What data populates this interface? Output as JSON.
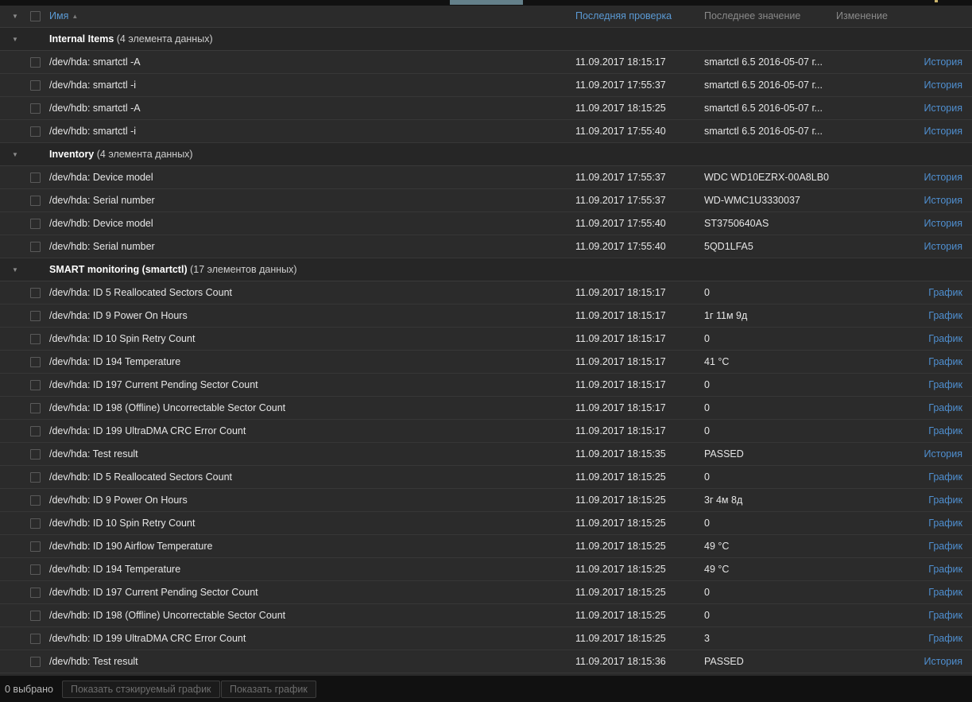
{
  "header": {
    "caret": "▼",
    "columns": {
      "name": "Имя",
      "sort_arrow": "▲",
      "last_check": "Последняя проверка",
      "last_value": "Последнее значение",
      "change": "Изменение"
    }
  },
  "links": {
    "history": "История",
    "graph": "График"
  },
  "groups": [
    {
      "caret": "▼",
      "title": "Internal Items",
      "count": "(4 элемента данных)",
      "rows": [
        {
          "name": "/dev/hda: smartctl -A",
          "time": "11.09.2017 18:15:17",
          "value": "smartctl 6.5 2016-05-07 г...",
          "link": "История"
        },
        {
          "name": "/dev/hda: smartctl -i",
          "time": "11.09.2017 17:55:37",
          "value": "smartctl 6.5 2016-05-07 г...",
          "link": "История"
        },
        {
          "name": "/dev/hdb: smartctl -A",
          "time": "11.09.2017 18:15:25",
          "value": "smartctl 6.5 2016-05-07 г...",
          "link": "История"
        },
        {
          "name": "/dev/hdb: smartctl -i",
          "time": "11.09.2017 17:55:40",
          "value": "smartctl 6.5 2016-05-07 г...",
          "link": "История"
        }
      ]
    },
    {
      "caret": "▼",
      "title": "Inventory",
      "count": "(4 элемента данных)",
      "rows": [
        {
          "name": "/dev/hda: Device model",
          "time": "11.09.2017 17:55:37",
          "value": "WDC WD10EZRX-00A8LB0",
          "link": "История"
        },
        {
          "name": "/dev/hda: Serial number",
          "time": "11.09.2017 17:55:37",
          "value": "WD-WMC1U3330037",
          "link": "История"
        },
        {
          "name": "/dev/hdb: Device model",
          "time": "11.09.2017 17:55:40",
          "value": "ST3750640AS",
          "link": "История"
        },
        {
          "name": "/dev/hdb: Serial number",
          "time": "11.09.2017 17:55:40",
          "value": "5QD1LFA5",
          "link": "История"
        }
      ]
    },
    {
      "caret": "▼",
      "title": "SMART monitoring (smartctl)",
      "count": "(17 элементов данных)",
      "rows": [
        {
          "name": "/dev/hda: ID 5 Reallocated Sectors Count",
          "time": "11.09.2017 18:15:17",
          "value": "0",
          "link": "График"
        },
        {
          "name": "/dev/hda: ID 9 Power On Hours",
          "time": "11.09.2017 18:15:17",
          "value": "1г 11м 9д",
          "link": "График"
        },
        {
          "name": "/dev/hda: ID 10 Spin Retry Count",
          "time": "11.09.2017 18:15:17",
          "value": "0",
          "link": "График"
        },
        {
          "name": "/dev/hda: ID 194 Temperature",
          "time": "11.09.2017 18:15:17",
          "value": "41 °C",
          "link": "График"
        },
        {
          "name": "/dev/hda: ID 197 Current Pending Sector Count",
          "time": "11.09.2017 18:15:17",
          "value": "0",
          "link": "График"
        },
        {
          "name": "/dev/hda: ID 198 (Offline) Uncorrectable Sector Count",
          "time": "11.09.2017 18:15:17",
          "value": "0",
          "link": "График"
        },
        {
          "name": "/dev/hda: ID 199 UltraDMA CRC Error Count",
          "time": "11.09.2017 18:15:17",
          "value": "0",
          "link": "График"
        },
        {
          "name": "/dev/hda: Test result",
          "time": "11.09.2017 18:15:35",
          "value": "PASSED",
          "link": "История"
        },
        {
          "name": "/dev/hdb: ID 5 Reallocated Sectors Count",
          "time": "11.09.2017 18:15:25",
          "value": "0",
          "link": "График"
        },
        {
          "name": "/dev/hdb: ID 9 Power On Hours",
          "time": "11.09.2017 18:15:25",
          "value": "3г 4м 8д",
          "link": "График"
        },
        {
          "name": "/dev/hdb: ID 10 Spin Retry Count",
          "time": "11.09.2017 18:15:25",
          "value": "0",
          "link": "График"
        },
        {
          "name": "/dev/hdb: ID 190 Airflow Temperature",
          "time": "11.09.2017 18:15:25",
          "value": "49 °C",
          "link": "График"
        },
        {
          "name": "/dev/hdb: ID 194 Temperature",
          "time": "11.09.2017 18:15:25",
          "value": "49 °C",
          "link": "График"
        },
        {
          "name": "/dev/hdb: ID 197 Current Pending Sector Count",
          "time": "11.09.2017 18:15:25",
          "value": "0",
          "link": "График"
        },
        {
          "name": "/dev/hdb: ID 198 (Offline) Uncorrectable Sector Count",
          "time": "11.09.2017 18:15:25",
          "value": "0",
          "link": "График"
        },
        {
          "name": "/dev/hdb: ID 199 UltraDMA CRC Error Count",
          "time": "11.09.2017 18:15:25",
          "value": "3",
          "link": "График"
        },
        {
          "name": "/dev/hdb: Test result",
          "time": "11.09.2017 18:15:36",
          "value": "PASSED",
          "link": "История"
        }
      ]
    }
  ],
  "footer": {
    "selected_label": "0 выбрано",
    "show_stacked_graph": "Показать стэкируемый график",
    "show_graph": "Показать график"
  },
  "colors": {
    "link": "#4f8fd0",
    "header_link": "#5b9ad4",
    "row_bg": "#2b2b2b",
    "group_bg": "#262626",
    "page_bg": "#111111",
    "tab_accent": "#64808a"
  }
}
